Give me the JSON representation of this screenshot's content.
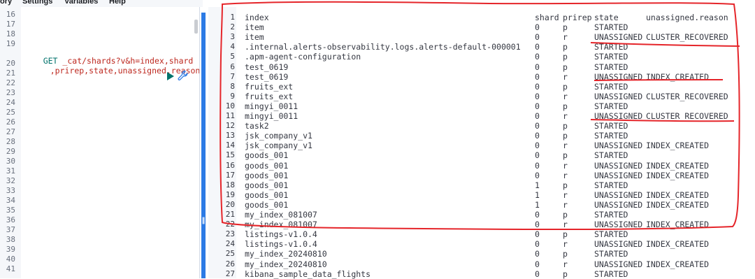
{
  "menu": {
    "items": [
      "ory",
      "Settings",
      "Variables",
      "Help"
    ]
  },
  "request_editor": {
    "line_numbers": [
      "16",
      "17",
      "18",
      "19",
      "",
      "20",
      "21",
      "22",
      "23",
      "24",
      "25",
      "26",
      "27",
      "28",
      "29",
      "30",
      "31",
      "32",
      "33",
      "34",
      "35",
      "36",
      "37",
      "38",
      "39",
      "40",
      "41"
    ],
    "request_method": "GET",
    "request_url_part1": "_cat/shards?v&h=index,shard",
    "request_url_part2": ",prirep,state,unassigned.reason"
  },
  "response": {
    "line_numbers": [
      "1",
      "2",
      "3",
      "4",
      "5",
      "6",
      "7",
      "8",
      "9",
      "10",
      "11",
      "12",
      "13",
      "14",
      "15",
      "16",
      "17",
      "18",
      "19",
      "20",
      "21",
      "22",
      "23",
      "24",
      "25",
      "26",
      "27"
    ],
    "header": {
      "index": "index",
      "shard": "shard",
      "prirep": "prirep",
      "state": "state",
      "reason": "unassigned.reason"
    },
    "rows": [
      {
        "index": "item",
        "shard": "0",
        "prirep": "p",
        "state": "STARTED",
        "reason": ""
      },
      {
        "index": "item",
        "shard": "0",
        "prirep": "r",
        "state": "UNASSIGNED",
        "reason": "CLUSTER_RECOVERED"
      },
      {
        "index": ".internal.alerts-observability.logs.alerts-default-000001",
        "shard": "0",
        "prirep": "p",
        "state": "STARTED",
        "reason": ""
      },
      {
        "index": ".apm-agent-configuration",
        "shard": "0",
        "prirep": "p",
        "state": "STARTED",
        "reason": ""
      },
      {
        "index": "test_0619",
        "shard": "0",
        "prirep": "p",
        "state": "STARTED",
        "reason": ""
      },
      {
        "index": "test_0619",
        "shard": "0",
        "prirep": "r",
        "state": "UNASSIGNED",
        "reason": "INDEX_CREATED"
      },
      {
        "index": "fruits_ext",
        "shard": "0",
        "prirep": "p",
        "state": "STARTED",
        "reason": ""
      },
      {
        "index": "fruits_ext",
        "shard": "0",
        "prirep": "r",
        "state": "UNASSIGNED",
        "reason": "CLUSTER_RECOVERED"
      },
      {
        "index": "mingyi_0011",
        "shard": "0",
        "prirep": "p",
        "state": "STARTED",
        "reason": ""
      },
      {
        "index": "mingyi_0011",
        "shard": "0",
        "prirep": "r",
        "state": "UNASSIGNED",
        "reason": "CLUSTER_RECOVERED"
      },
      {
        "index": "task2",
        "shard": "0",
        "prirep": "p",
        "state": "STARTED",
        "reason": ""
      },
      {
        "index": "jsk_company_v1",
        "shard": "0",
        "prirep": "p",
        "state": "STARTED",
        "reason": ""
      },
      {
        "index": "jsk_company_v1",
        "shard": "0",
        "prirep": "r",
        "state": "UNASSIGNED",
        "reason": "INDEX_CREATED"
      },
      {
        "index": "goods_001",
        "shard": "0",
        "prirep": "p",
        "state": "STARTED",
        "reason": ""
      },
      {
        "index": "goods_001",
        "shard": "0",
        "prirep": "r",
        "state": "UNASSIGNED",
        "reason": "INDEX_CREATED"
      },
      {
        "index": "goods_001",
        "shard": "0",
        "prirep": "r",
        "state": "UNASSIGNED",
        "reason": "INDEX_CREATED"
      },
      {
        "index": "goods_001",
        "shard": "1",
        "prirep": "p",
        "state": "STARTED",
        "reason": ""
      },
      {
        "index": "goods_001",
        "shard": "1",
        "prirep": "r",
        "state": "UNASSIGNED",
        "reason": "INDEX_CREATED"
      },
      {
        "index": "goods_001",
        "shard": "1",
        "prirep": "r",
        "state": "UNASSIGNED",
        "reason": "INDEX_CREATED"
      },
      {
        "index": "my_index_081007",
        "shard": "0",
        "prirep": "p",
        "state": "STARTED",
        "reason": ""
      },
      {
        "index": "my_index_081007",
        "shard": "0",
        "prirep": "r",
        "state": "UNASSIGNED",
        "reason": "INDEX_CREATED"
      },
      {
        "index": "listings-v1.0.4",
        "shard": "0",
        "prirep": "p",
        "state": "STARTED",
        "reason": ""
      },
      {
        "index": "listings-v1.0.4",
        "shard": "0",
        "prirep": "r",
        "state": "UNASSIGNED",
        "reason": "INDEX_CREATED"
      },
      {
        "index": "my_index_20240810",
        "shard": "0",
        "prirep": "p",
        "state": "STARTED",
        "reason": ""
      },
      {
        "index": "my_index_20240810",
        "shard": "0",
        "prirep": "r",
        "state": "UNASSIGNED",
        "reason": "INDEX_CREATED"
      },
      {
        "index": "kibana_sample_data_flights",
        "shard": "0",
        "prirep": "p",
        "state": "STARTED",
        "reason": ""
      }
    ]
  },
  "colors": {
    "annotation": "#e5252a",
    "accent": "#2c7be5",
    "play": "#00726b"
  },
  "icons": {
    "play": "play-icon",
    "wrench": "wrench-icon",
    "grip": "drag-handle-icon"
  }
}
